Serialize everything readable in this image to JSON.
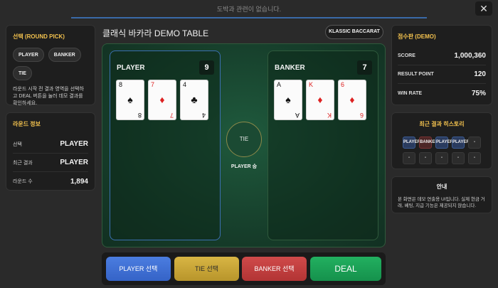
{
  "banner": {
    "text": "도박과 관련이 없습니다."
  },
  "close": {
    "label": "✕"
  },
  "pick": {
    "title": "선택 (ROUND PICK)",
    "options": [
      "PLAYER",
      "BANKER",
      "TIE"
    ],
    "description": "라운드 시작 전 결과 영역을 선택하고 DEAL 버튼을 눌러 데모 결과를 확인하세요."
  },
  "round": {
    "title": "라운드 정보",
    "rows": [
      {
        "label": "선택",
        "value": "PLAYER"
      },
      {
        "label": "최근 결과",
        "value": "PLAYER"
      },
      {
        "label": "라운드 수",
        "value": "1,894"
      }
    ]
  },
  "table": {
    "title": "클래식 바카라 DEMO TABLE",
    "mode_button": "KLASSIC BACCARAT",
    "player": {
      "label": "PLAYER",
      "score": "9",
      "cards": [
        {
          "rank": "8",
          "suit": "♠",
          "color": "black"
        },
        {
          "rank": "7",
          "suit": "♦",
          "color": "red"
        },
        {
          "rank": "4",
          "suit": "♣",
          "color": "black"
        }
      ]
    },
    "banker": {
      "label": "BANKER",
      "score": "7",
      "cards": [
        {
          "rank": "A",
          "suit": "♠",
          "color": "black"
        },
        {
          "rank": "K",
          "suit": "♦",
          "color": "red"
        },
        {
          "rank": "6",
          "suit": "♦",
          "color": "red"
        }
      ]
    },
    "tie_label": "TIE",
    "winner_text": "PLAYER 승"
  },
  "actions": {
    "player": "PLAYER 선택",
    "tie": "TIE 선택",
    "banker": "BANKER 선택",
    "deal": "DEAL"
  },
  "points": {
    "title": "점수판 (DEMO)",
    "rows": [
      {
        "label": "SCORE",
        "value": "1,000,360"
      },
      {
        "label": "RESULT POINT",
        "value": "120"
      },
      {
        "label": "WIN RATE",
        "value": "75%"
      }
    ]
  },
  "history": {
    "title": "최근 결과 히스토리",
    "cells": [
      {
        "text": "PLAYER",
        "kind": "p"
      },
      {
        "text": "BANKER",
        "kind": "b"
      },
      {
        "text": "PLAYER",
        "kind": "p"
      },
      {
        "text": "PLAYER",
        "kind": "p"
      },
      {
        "text": "-",
        "kind": ""
      },
      {
        "text": "-",
        "kind": ""
      },
      {
        "text": "-",
        "kind": ""
      },
      {
        "text": "-",
        "kind": ""
      },
      {
        "text": "-",
        "kind": ""
      },
      {
        "text": "-",
        "kind": ""
      }
    ]
  },
  "notice": {
    "title": "안내",
    "text": "본 화면은 데모 연출용 UI입니다. 실제 현금 거래, 베팅, 지급 기능은 제공되지 않습니다."
  },
  "colors": {
    "accent": "#f2c14e",
    "player": "#3563c7",
    "banker": "#b23434",
    "tie": "#b8952b",
    "deal": "#15914c",
    "felt": "#1f5a3d"
  }
}
